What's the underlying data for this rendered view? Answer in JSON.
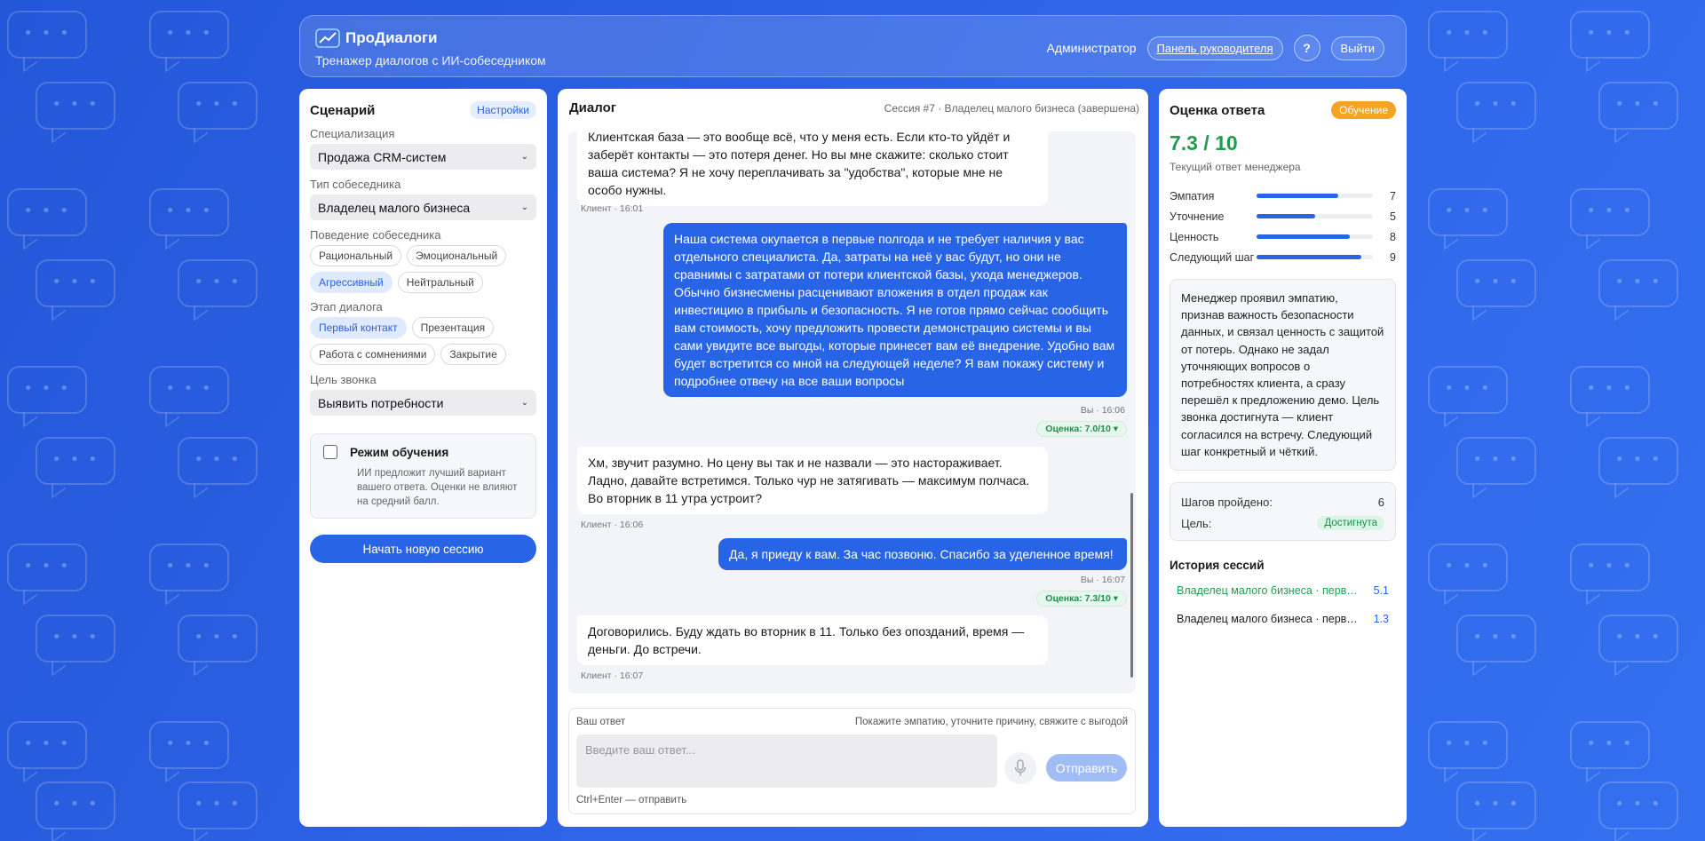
{
  "app": {
    "name": "ПроДиалоги",
    "subtitle": "Тренажер диалогов с ИИ-собеседником"
  },
  "header": {
    "user": "Администратор",
    "dashboard_link": "Панель руководителя",
    "help": "?",
    "logout": "Выйти"
  },
  "scenario": {
    "title": "Сценарий",
    "settings_label": "Настройки",
    "specialization_label": "Специализация",
    "specialization_value": "Продажа CRM-систем",
    "partner_type_label": "Тип собеседника",
    "partner_type_value": "Владелец малого бизнеса",
    "behavior_label": "Поведение собеседника",
    "behavior_options": [
      "Рациональный",
      "Эмоциональный",
      "Агрессивный",
      "Нейтральный"
    ],
    "behavior_selected": "Агрессивный",
    "stage_label": "Этап диалога",
    "stage_options": [
      "Первый контакт",
      "Презентация",
      "Работа с сомнениями",
      "Закрытие"
    ],
    "stage_selected": "Первый контакт",
    "goal_label": "Цель звонка",
    "goal_value": "Выявить потребности",
    "training_mode_label": "Режим обучения",
    "training_mode_desc": "ИИ предложит лучший вариант вашего ответа. Оценки не влияют на средний балл.",
    "start_button": "Начать новую сессию"
  },
  "dialog": {
    "title": "Диалог",
    "session_info": "Сессия #7 · Владелец малого бизнеса (завершена)",
    "messages": [
      {
        "role": "client",
        "text": "Клиентская база — это вообще всё, что у меня есть. Если кто-то уйдёт и заберёт контакты — это потеря денег. Но вы мне скажите: сколько стоит ваша система? Я не хочу переплачивать за \"удобства\", которые мне не особо нужны.",
        "meta": "Клиент · 16:01"
      },
      {
        "role": "me",
        "text": "Наша система окупается в первые полгода и не требует наличия у вас отдельного специалиста. Да, затраты на неё у вас будут, но они не сравнимы с затратами от потери клиентской базы, ухода менеджеров. Обычно бизнесмены расценивают вложения в отдел продаж как инвестицию в прибыль и безопасность. Я не готов прямо сейчас сообщить вам стоимость, хочу предложить провести демонстрацию системы и вы сами увидите все выгоды, которые принесет вам её внедрение. Удобно вам будет встретится со мной на следующей неделе? Я вам покажу систему и подробнее отвечу на все ваши вопросы",
        "meta": "Вы · 16:06",
        "score": "Оценка: 7.0/10 ▾"
      },
      {
        "role": "client",
        "text": "Хм, звучит разумно. Но цену вы так и не назвали — это настораживает. Ладно, давайте встретимся. Только чур не затягивать — максимум полчаса. Во вторник в 11 утра устроит?",
        "meta": "Клиент · 16:06"
      },
      {
        "role": "me",
        "text": "Да, я приеду к вам. За час позвоню. Спасибо за уделенное время!",
        "meta": "Вы · 16:07",
        "score": "Оценка: 7.3/10 ▾"
      },
      {
        "role": "client",
        "text": "Договорились. Буду ждать во вторник в 11. Только без опозданий, время — деньги. До встречи.",
        "meta": "Клиент · 16:07"
      }
    ]
  },
  "composer": {
    "label": "Ваш ответ",
    "hint": "Покажите эмпатию, уточните причину, свяжите с выгодой",
    "placeholder": "Введите ваш ответ...",
    "send": "Отправить",
    "shortcut": "Ctrl+Enter — отправить",
    "mic_icon": "microphone-icon"
  },
  "evaluation": {
    "title": "Оценка ответа",
    "mode_badge": "Обучение",
    "score": "7.3 / 10",
    "score_caption": "Текущий ответ менеджера",
    "metrics": [
      {
        "name": "Эмпатия",
        "value": "7",
        "level": 0.7
      },
      {
        "name": "Уточнение",
        "value": "5",
        "level": 0.5
      },
      {
        "name": "Ценность",
        "value": "8",
        "level": 0.8
      },
      {
        "name": "Следующий шаг",
        "value": "9",
        "level": 0.9
      }
    ],
    "feedback": "Менеджер проявил эмпатию, признав важность безопасности данных, и связал ценность с защитой от потерь. Однако не задал уточняющих вопросов о потребностях клиента, а сразу перешёл к предложению демо. Цель звонка достигнута — клиент согласился на встречу. Следующий шаг конкретный и чёткий.",
    "steps_label": "Шагов пройдено:",
    "steps_value": "6",
    "goal_label": "Цель:",
    "goal_status": "Достигнута",
    "colors": {
      "accent": "#2764e6",
      "score_green": "#1f9c4c",
      "badge_orange": "#f5a41f"
    }
  },
  "history": {
    "title": "История сессий",
    "items": [
      {
        "label": "Владелец малого бизнеса · первы...",
        "score": "5.1",
        "active": true
      },
      {
        "label": "Владелец малого бизнеса · первы...",
        "score": "1.3",
        "active": false
      }
    ]
  }
}
